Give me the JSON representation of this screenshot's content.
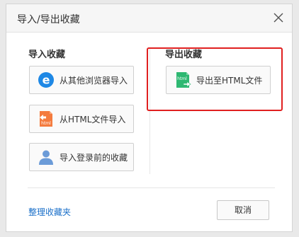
{
  "dialog": {
    "title": "导入/导出收藏"
  },
  "import": {
    "section_title": "导入收藏",
    "buttons": [
      {
        "label": "从其他浏览器导入",
        "icon": "ie-browser-icon"
      },
      {
        "label": "从HTML文件导入",
        "icon": "html-file-import-icon"
      },
      {
        "label": "导入登录前的收藏",
        "icon": "user-icon"
      }
    ]
  },
  "export": {
    "section_title": "导出收藏",
    "buttons": [
      {
        "label": "导出至HTML文件",
        "icon": "html-file-export-icon"
      }
    ]
  },
  "footer": {
    "manage_link": "整理收藏夹",
    "cancel_label": "取消"
  },
  "colors": {
    "highlight": "#e02020",
    "link": "#1a6fc9",
    "ie_blue": "#1e88e5",
    "html_orange": "#f47b3e",
    "html_green": "#2eb872",
    "user_blue": "#6b9bd8"
  }
}
